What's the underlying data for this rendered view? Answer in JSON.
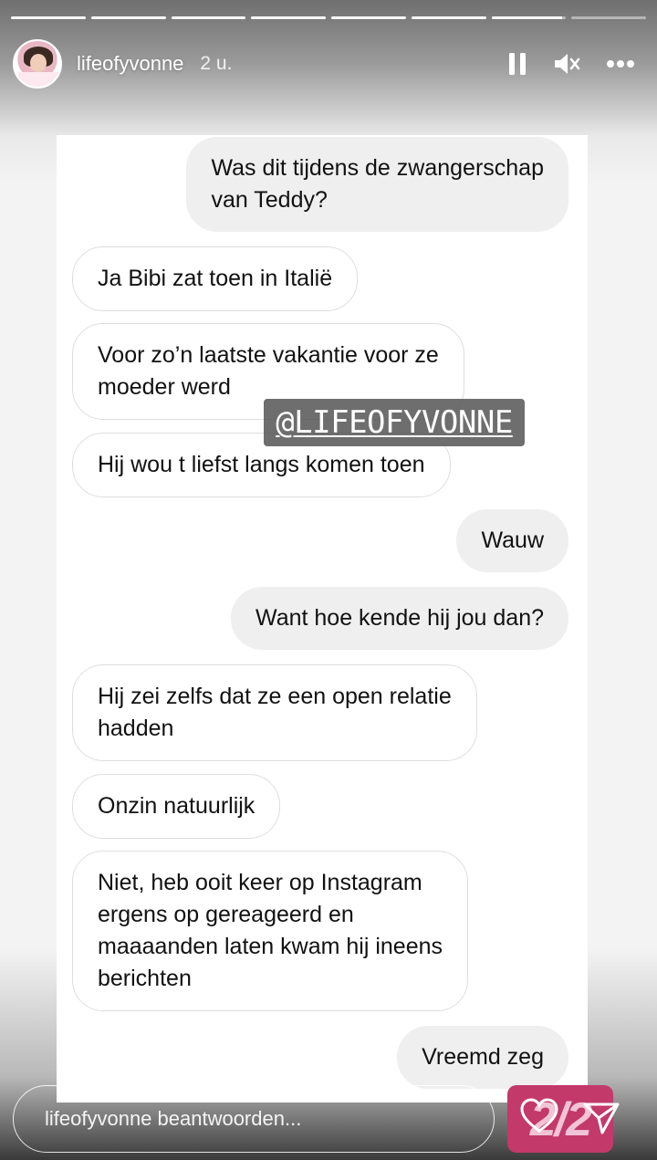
{
  "story": {
    "username": "lifeofyvonne",
    "time": "2 u.",
    "progress": [
      1,
      1,
      1,
      1,
      1,
      1,
      0.95,
      0
    ]
  },
  "messages": [
    {
      "dir": "out",
      "text": "Was dit tijdens de zwangerschap\nvan Teddy?"
    },
    {
      "dir": "in",
      "text": "Ja Bibi zat toen in Italië"
    },
    {
      "dir": "in",
      "text": "Voor zo’n laatste vakantie voor ze\nmoeder werd"
    },
    {
      "dir": "in",
      "text": "Hij wou t liefst langs komen toen"
    },
    {
      "dir": "out",
      "text": "Wauw"
    },
    {
      "dir": "out",
      "text": "Want hoe kende hij jou dan?"
    },
    {
      "dir": "in",
      "text": "Hij zei zelfs dat ze een open relatie\nhadden"
    },
    {
      "dir": "in",
      "text": "Onzin natuurlijk"
    },
    {
      "dir": "in",
      "text": "Niet, heb ooit keer op Instagram\nergens op gereageerd en\nmaaaanden laten kwam hij ineens\nberichten"
    },
    {
      "dir": "out",
      "text": "Vreemd zeg"
    }
  ],
  "watermark": "@LIFEOFYVONNE",
  "reply": {
    "placeholder": "lifeofyvonne beantwoorden...",
    "sticker": "2/2"
  },
  "icons": {
    "pause": "pause-icon",
    "mute": "speaker-muted-icon",
    "more": "more-dots-icon",
    "like": "heart-icon",
    "send": "send-icon"
  }
}
